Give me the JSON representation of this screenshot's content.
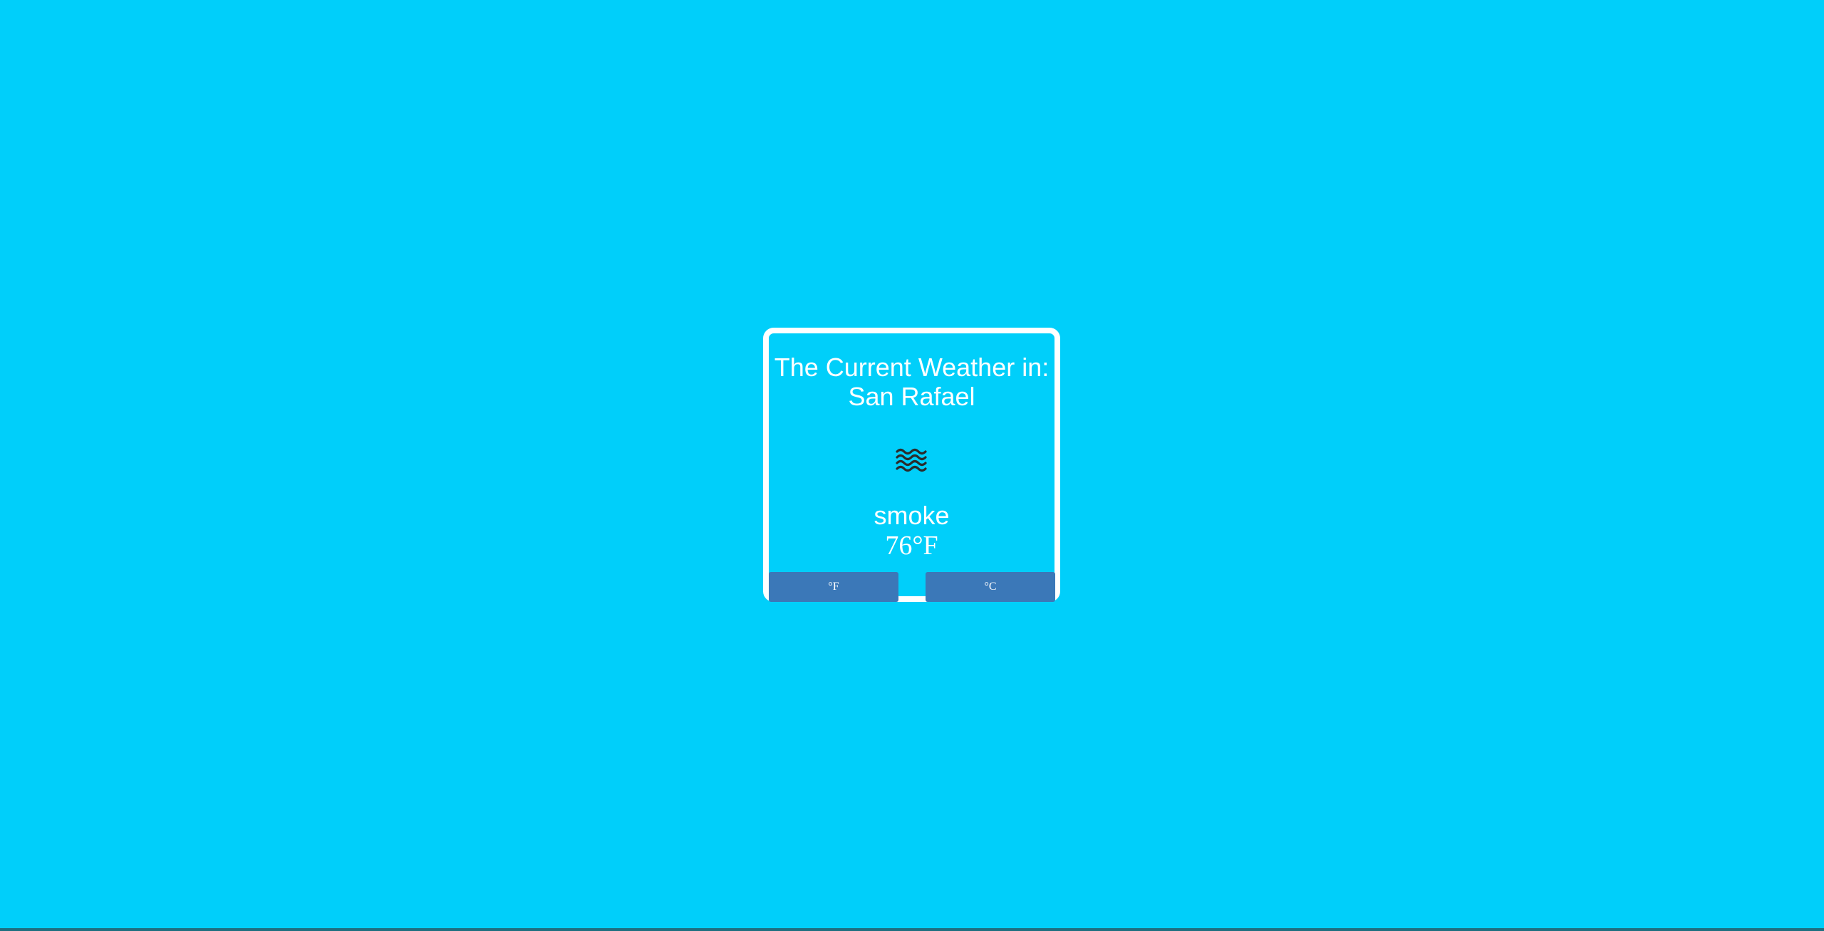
{
  "page": {
    "background_color": "#00cffa"
  },
  "card": {
    "title": "The Current Weather in:",
    "city": "San Rafael",
    "icon": "fog-waves-icon",
    "condition": "smoke",
    "temperature": "76°F",
    "border_color": "#ffffff"
  },
  "units": {
    "fahrenheit_label": "°F",
    "celsius_label": "°C",
    "button_color": "#3b78b8"
  }
}
